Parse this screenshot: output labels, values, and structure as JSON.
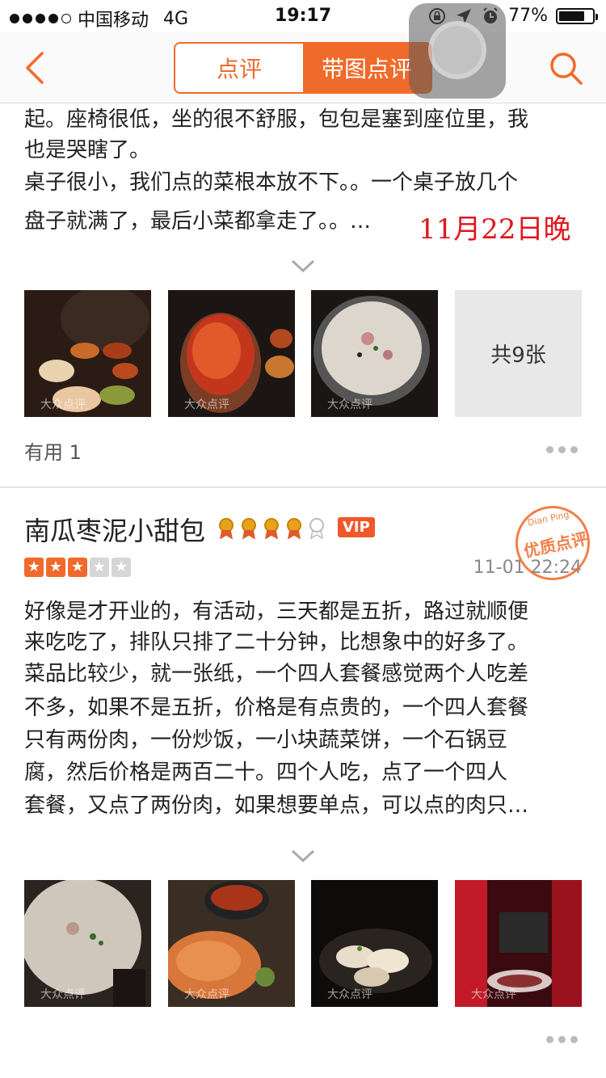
{
  "status_bar": {
    "carrier": "中国移动",
    "network": "4G",
    "time": "19:17",
    "battery": "77%",
    "battery_level": 0.77
  },
  "nav": {
    "tab_review": "点评",
    "tab_photo_review": "带图点评",
    "active_tab": "带图点评",
    "accent_color": "#f06a2b"
  },
  "review1": {
    "lines": [
      "起。座椅很低，坐的很不舒服，包包是塞到座位里，我",
      "也是哭瞎了。",
      "桌子很小，我们点的菜根本放不下。。一个桌子放几个",
      "盘子就满了，最后小菜都拿走了。。…"
    ],
    "date_stamp": "11月22日晚",
    "more_photos": "共9张",
    "useful": "有用 1",
    "watermark": "大众点评"
  },
  "review2": {
    "username": "南瓜枣泥小甜包",
    "medals": 5,
    "medals_filled": 4,
    "vip_badge": "VIP",
    "rating": 3,
    "rating_max": 5,
    "date": "11-01 22:24",
    "quality_stamp": "优质点评",
    "stamp_text": "Dian Ping",
    "lines": [
      "好像是才开业的，有活动，三天都是五折，路过就顺便",
      "来吃吃了，排队只排了二十分钟，比想象中的好多了。",
      "菜品比较少，就一张纸，一个四人套餐感觉两个人吃差",
      "不多，如果不是五折，价格是有点贵的，一个四人套餐",
      "只有两份肉，一份炒饭，一小块蔬菜饼，一个石锅豆",
      "腐，然后价格是两百二十。四个人吃，点了一个四人",
      "套餐，又点了两份肉，如果想要单点，可以点的肉只…"
    ],
    "watermark": "大众点评"
  }
}
